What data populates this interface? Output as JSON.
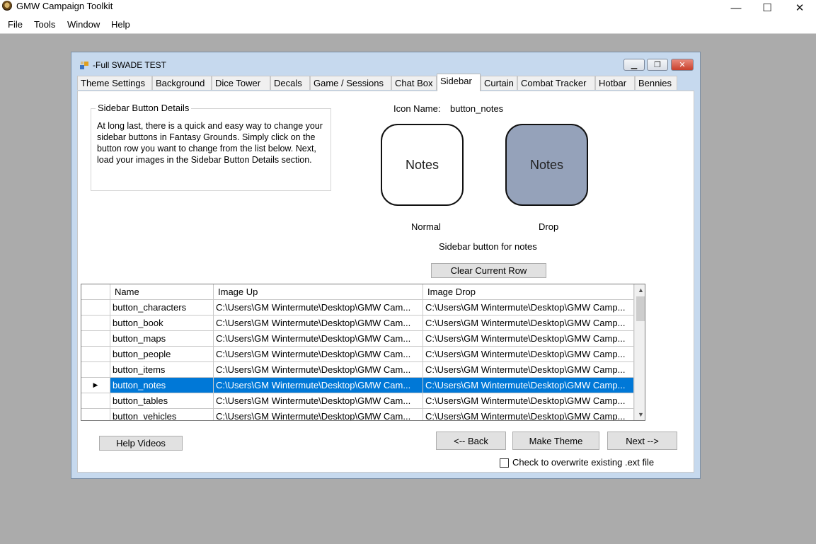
{
  "app": {
    "title": "GMW Campaign Toolkit",
    "window_controls": {
      "minimize": "—",
      "maximize": "☐",
      "close": "✕"
    }
  },
  "menu": [
    "File",
    "Tools",
    "Window",
    "Help"
  ],
  "child_window": {
    "title": "-Full SWADE TEST",
    "controls": {
      "minimize": "▁",
      "restore": "❐",
      "close": "✕"
    }
  },
  "tabs": [
    {
      "label": "Theme Settings",
      "active": false
    },
    {
      "label": "Background",
      "active": false
    },
    {
      "label": "Dice Tower",
      "active": false
    },
    {
      "label": "Decals",
      "active": false
    },
    {
      "label": "Game / Sessions",
      "active": false
    },
    {
      "label": "Chat Box",
      "active": false
    },
    {
      "label": "Sidebar",
      "active": true
    },
    {
      "label": "Curtain",
      "active": false
    },
    {
      "label": "Combat Tracker",
      "active": false
    },
    {
      "label": "Hotbar",
      "active": false
    },
    {
      "label": "Bennies",
      "active": false
    }
  ],
  "details": {
    "title": "Sidebar Button Details",
    "text": "At long last, there is a quick and easy way to change your sidebar buttons in Fantasy Grounds.  Simply click on the button row you want to change from the list below.  Next, load your images in the Sidebar Button Details section."
  },
  "icon": {
    "name_label": "Icon Name:",
    "name_value": "button_notes",
    "normal_preview_text": "Notes",
    "drop_preview_text": "Notes",
    "normal_label": "Normal",
    "drop_label": "Drop",
    "description": "Sidebar button for notes"
  },
  "clear_row_label": "Clear Current Row",
  "grid": {
    "headers": [
      "Name",
      "Image Up",
      "Image Drop"
    ],
    "selected_row_marker": "▶",
    "rows": [
      {
        "name": "button_characters",
        "up": "C:\\Users\\GM Wintermute\\Desktop\\GMW Cam...",
        "drop": "C:\\Users\\GM Wintermute\\Desktop\\GMW Camp..."
      },
      {
        "name": "button_book",
        "up": "C:\\Users\\GM Wintermute\\Desktop\\GMW Cam...",
        "drop": "C:\\Users\\GM Wintermute\\Desktop\\GMW Camp..."
      },
      {
        "name": "button_maps",
        "up": "C:\\Users\\GM Wintermute\\Desktop\\GMW Cam...",
        "drop": "C:\\Users\\GM Wintermute\\Desktop\\GMW Camp..."
      },
      {
        "name": "button_people",
        "up": "C:\\Users\\GM Wintermute\\Desktop\\GMW Cam...",
        "drop": "C:\\Users\\GM Wintermute\\Desktop\\GMW Camp..."
      },
      {
        "name": "button_items",
        "up": "C:\\Users\\GM Wintermute\\Desktop\\GMW Cam...",
        "drop": "C:\\Users\\GM Wintermute\\Desktop\\GMW Camp..."
      },
      {
        "name": "button_notes",
        "up": "C:\\Users\\GM Wintermute\\Desktop\\GMW Cam...",
        "drop": "C:\\Users\\GM Wintermute\\Desktop\\GMW Camp...",
        "selected": true
      },
      {
        "name": "button_tables",
        "up": "C:\\Users\\GM Wintermute\\Desktop\\GMW Cam...",
        "drop": "C:\\Users\\GM Wintermute\\Desktop\\GMW Camp..."
      },
      {
        "name": "button_vehicles",
        "up": "C:\\Users\\GM Wintermute\\Desktop\\GMW Cam...",
        "drop": "C:\\Users\\GM Wintermute\\Desktop\\GMW Camp..."
      }
    ]
  },
  "buttons": {
    "help_videos": "Help Videos",
    "back": "<-- Back",
    "make_theme": "Make Theme",
    "next": "Next -->"
  },
  "overwrite_label": "Check to overwrite existing .ext file",
  "colors": {
    "selection": "#0078d7",
    "drop_preview_bg": "#95a2ba",
    "workspace_bg": "#ababab",
    "child_frame": "#c6d9ee"
  }
}
